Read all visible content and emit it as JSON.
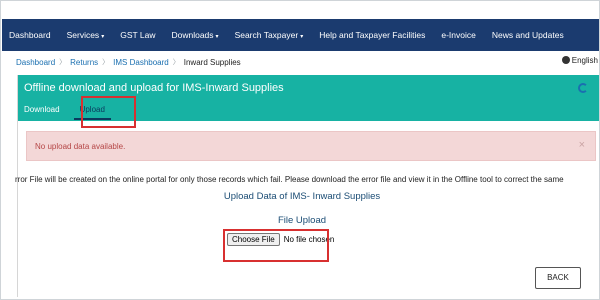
{
  "nav": {
    "items": [
      {
        "label": "Dashboard",
        "caret": false
      },
      {
        "label": "Services",
        "caret": true
      },
      {
        "label": "GST Law",
        "caret": false
      },
      {
        "label": "Downloads",
        "caret": true
      },
      {
        "label": "Search Taxpayer",
        "caret": true
      },
      {
        "label": "Help and Taxpayer Facilities",
        "caret": false
      },
      {
        "label": "e-Invoice",
        "caret": false
      },
      {
        "label": "News and Updates",
        "caret": false
      }
    ],
    "caret_glyph": "▾"
  },
  "breadcrumb": {
    "items": [
      "Dashboard",
      "Returns",
      "IMS Dashboard",
      "Inward Supplies"
    ],
    "separator": "〉",
    "language": "English"
  },
  "card": {
    "title": "Offline download and upload for IMS-Inward Supplies",
    "tabs": [
      "Download",
      "Upload"
    ],
    "active_tab": "Upload"
  },
  "alert": {
    "message": "No upload data available.",
    "close_glyph": "×"
  },
  "content": {
    "info": "rror File will be created on the online portal for only those records which fail. Please download the error file and view it in the Offline tool to correct the same",
    "heading": "Upload Data of IMS- Inward Supplies",
    "file_label": "File Upload",
    "choose_button": "Choose File",
    "no_file": "No file chosen",
    "back_button": "BACK"
  },
  "colors": {
    "navbar": "#1b3b6f",
    "header": "#17b2a3",
    "highlight": "#d83030",
    "alert_bg": "#f3d7d7"
  }
}
